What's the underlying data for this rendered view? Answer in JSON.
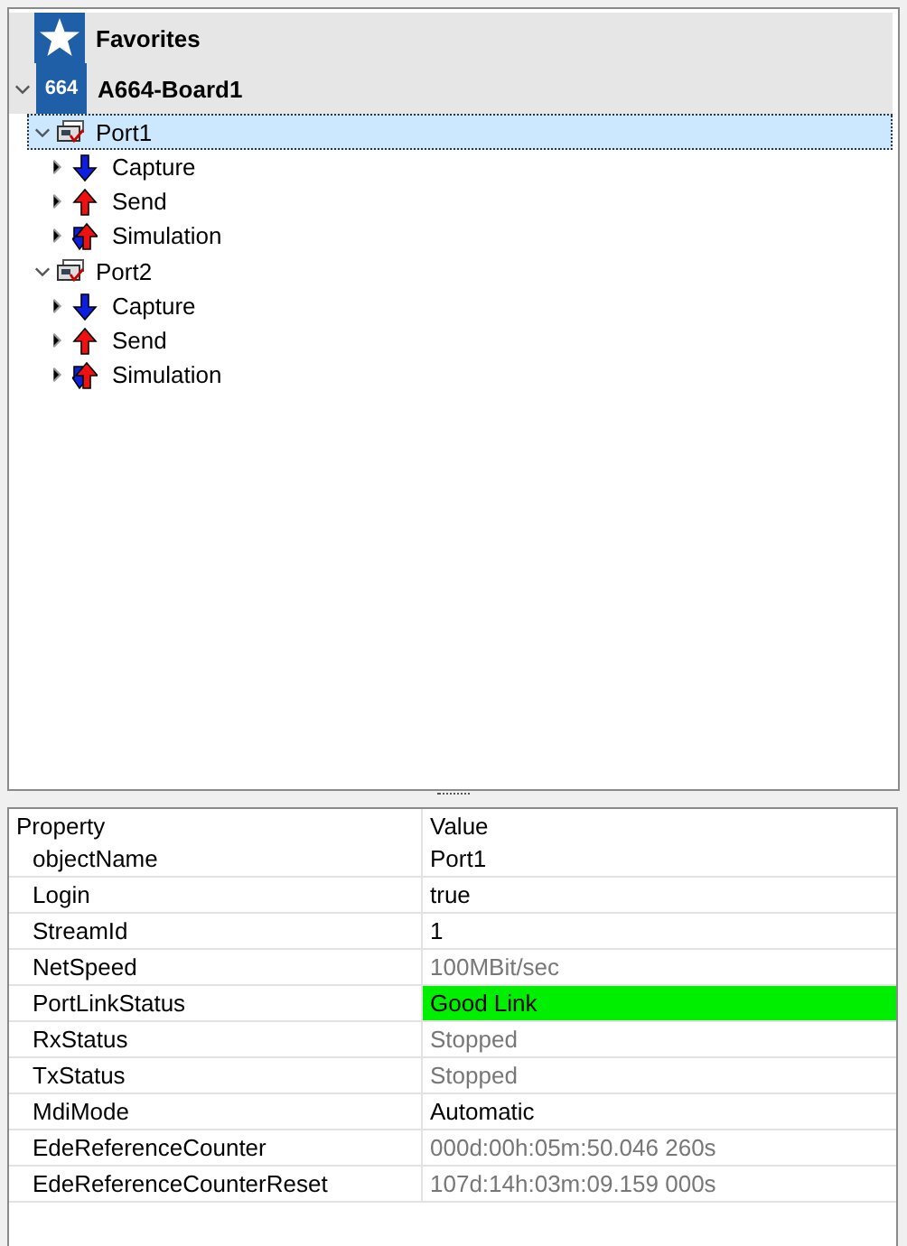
{
  "tree": {
    "favorites": {
      "label": "Favorites"
    },
    "board": {
      "badge": "664",
      "label": "A664-Board1",
      "expanded": true,
      "ports": [
        {
          "label": "Port1",
          "expanded": true,
          "selected": true,
          "children": [
            {
              "label": "Capture",
              "kind": "capture",
              "expanded": false
            },
            {
              "label": "Send",
              "kind": "send",
              "expanded": false
            },
            {
              "label": "Simulation",
              "kind": "simulation",
              "expanded": false
            }
          ]
        },
        {
          "label": "Port2",
          "expanded": true,
          "selected": false,
          "children": [
            {
              "label": "Capture",
              "kind": "capture",
              "expanded": false
            },
            {
              "label": "Send",
              "kind": "send",
              "expanded": false
            },
            {
              "label": "Simulation",
              "kind": "simulation",
              "expanded": false
            }
          ]
        }
      ]
    }
  },
  "properties": {
    "columns": [
      "Property",
      "Value"
    ],
    "rows": [
      {
        "name": "objectName",
        "value": "Port1",
        "readonly": false,
        "highlighted": false
      },
      {
        "name": "Login",
        "value": "true",
        "readonly": false,
        "highlighted": false
      },
      {
        "name": "StreamId",
        "value": "1",
        "readonly": false,
        "highlighted": false
      },
      {
        "name": "NetSpeed",
        "value": "100MBit/sec",
        "readonly": true,
        "highlighted": false
      },
      {
        "name": "PortLinkStatus",
        "value": "Good Link",
        "readonly": false,
        "highlighted": true
      },
      {
        "name": "RxStatus",
        "value": "Stopped",
        "readonly": true,
        "highlighted": false
      },
      {
        "name": "TxStatus",
        "value": "Stopped",
        "readonly": true,
        "highlighted": false
      },
      {
        "name": "MdiMode",
        "value": "Automatic",
        "readonly": false,
        "highlighted": false
      },
      {
        "name": "EdeReferenceCounter",
        "value": "000d:00h:05m:50.046 260s",
        "readonly": true,
        "highlighted": false
      },
      {
        "name": "EdeReferenceCounterReset",
        "value": "107d:14h:03m:09.159 000s",
        "readonly": true,
        "highlighted": false
      }
    ]
  }
}
